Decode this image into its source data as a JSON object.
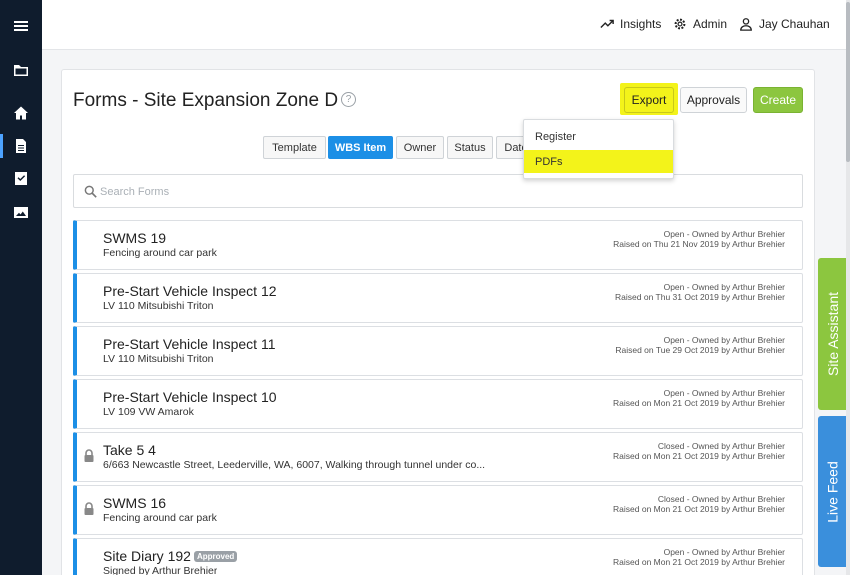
{
  "header": {
    "insights_label": "Insights",
    "admin_label": "Admin",
    "user_name": "Jay Chauhan"
  },
  "page": {
    "title": "Forms - Site Expansion Zone D",
    "help": "?"
  },
  "actions": {
    "export_label": "Export",
    "approvals_label": "Approvals",
    "create_label": "Create"
  },
  "export_menu": {
    "items": [
      "Register",
      "PDFs"
    ]
  },
  "group_tabs": [
    "Template",
    "WBS Item",
    "Owner",
    "Status",
    "Date"
  ],
  "search": {
    "placeholder": "Search Forms",
    "value": ""
  },
  "forms": [
    {
      "title": "SWMS 19",
      "subtitle": "Fencing around car park",
      "status": "Open - Owned by Arthur Brehier",
      "raised": "Raised on Thu 21 Nov 2019 by Arthur Brehier"
    },
    {
      "title": "Pre-Start Vehicle Inspect 12",
      "subtitle": "LV 110 Mitsubishi Triton",
      "status": "Open - Owned by Arthur Brehier",
      "raised": "Raised on Thu 31 Oct 2019 by Arthur Brehier"
    },
    {
      "title": "Pre-Start Vehicle Inspect 11",
      "subtitle": "LV 110 Mitsubishi Triton",
      "status": "Open - Owned by Arthur Brehier",
      "raised": "Raised on Tue 29 Oct 2019 by Arthur Brehier"
    },
    {
      "title": "Pre-Start Vehicle Inspect 10",
      "subtitle": "LV 109 VW Amarok",
      "status": "Open - Owned by Arthur Brehier",
      "raised": "Raised on Mon 21 Oct 2019 by Arthur Brehier"
    },
    {
      "title": "Take 5 4",
      "subtitle": "6/663 Newcastle Street, Leederville, WA, 6007, Walking through tunnel under co...",
      "status": "Closed - Owned by Arthur Brehier",
      "raised": "Raised on Mon 21 Oct 2019 by Arthur Brehier"
    },
    {
      "title": "SWMS 16",
      "subtitle": "Fencing around car park",
      "status": "Closed - Owned by Arthur Brehier",
      "raised": "Raised on Mon 21 Oct 2019 by Arthur Brehier"
    },
    {
      "title": "Site Diary 192",
      "badge": "Approved",
      "subtitle": "Signed by Arthur Brehier",
      "status": "Open - Owned by Arthur Brehier",
      "raised": "Raised on Mon 21 Oct 2019 by Arthur Brehier"
    }
  ],
  "side_tabs": {
    "site_assistant": "Site Assistant",
    "live_feed": "Live Feed"
  },
  "colors": {
    "sidebar": "#0f1c2d",
    "accent_blue": "#1c8fe6",
    "highlight_yellow": "#f3f31a",
    "create_green": "#8cc63f",
    "live_feed_blue": "#3a8fdc"
  }
}
